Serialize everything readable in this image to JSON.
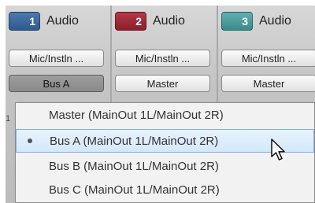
{
  "tracks": [
    {
      "number": "1",
      "name": "Audio",
      "color": "#2f5a8f",
      "input": "Mic/Instln ...",
      "output": "Bus A"
    },
    {
      "number": "2",
      "name": "Audio",
      "color": "#8a1f2a",
      "input": "Mic/Instln ...",
      "output": "Master"
    },
    {
      "number": "3",
      "name": "Audio",
      "color": "#3b8a8a",
      "input": "Mic/Instln ...",
      "output": "Master"
    }
  ],
  "dropdown": {
    "items": [
      {
        "label": "Master  (MainOut 1L/MainOut 2R)"
      },
      {
        "label": "Bus A  (MainOut 1L/MainOut 2R)",
        "selected": true
      },
      {
        "label": "Bus B  (MainOut 1L/MainOut 2R)"
      },
      {
        "label": "Bus C  (MainOut 1L/MainOut 2R)"
      }
    ]
  }
}
